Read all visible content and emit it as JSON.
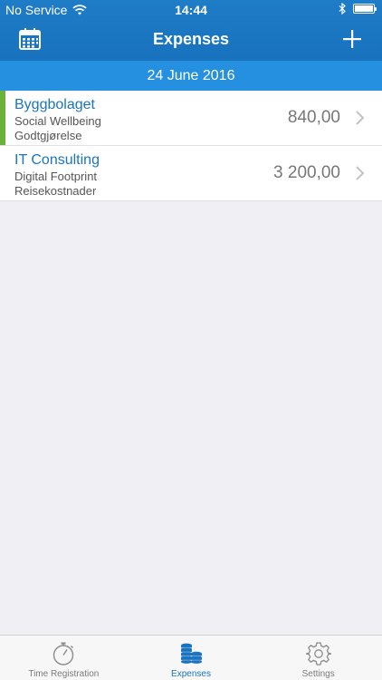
{
  "status_bar": {
    "carrier": "No Service",
    "time": "14:44"
  },
  "nav": {
    "title": "Expenses"
  },
  "date_header": "24 June 2016",
  "expenses": [
    {
      "customer": "Byggbolaget",
      "project": "Social Wellbeing",
      "category": "Godtgjørelse",
      "amount": "840,00",
      "highlighted": true
    },
    {
      "customer": "IT Consulting",
      "project": "Digital Footprint",
      "category": "Reisekostnader",
      "amount": "3 200,00",
      "highlighted": false
    }
  ],
  "tabs": [
    {
      "label": "Time Registration",
      "icon": "stopwatch-icon",
      "active": false
    },
    {
      "label": "Expenses",
      "icon": "coins-icon",
      "active": true
    },
    {
      "label": "Settings",
      "icon": "gear-icon",
      "active": false
    }
  ],
  "colors": {
    "header": "#1f7cc7",
    "date_bar": "#2590e0",
    "accent_green": "#6bb23a",
    "link_blue": "#1b74c0"
  }
}
